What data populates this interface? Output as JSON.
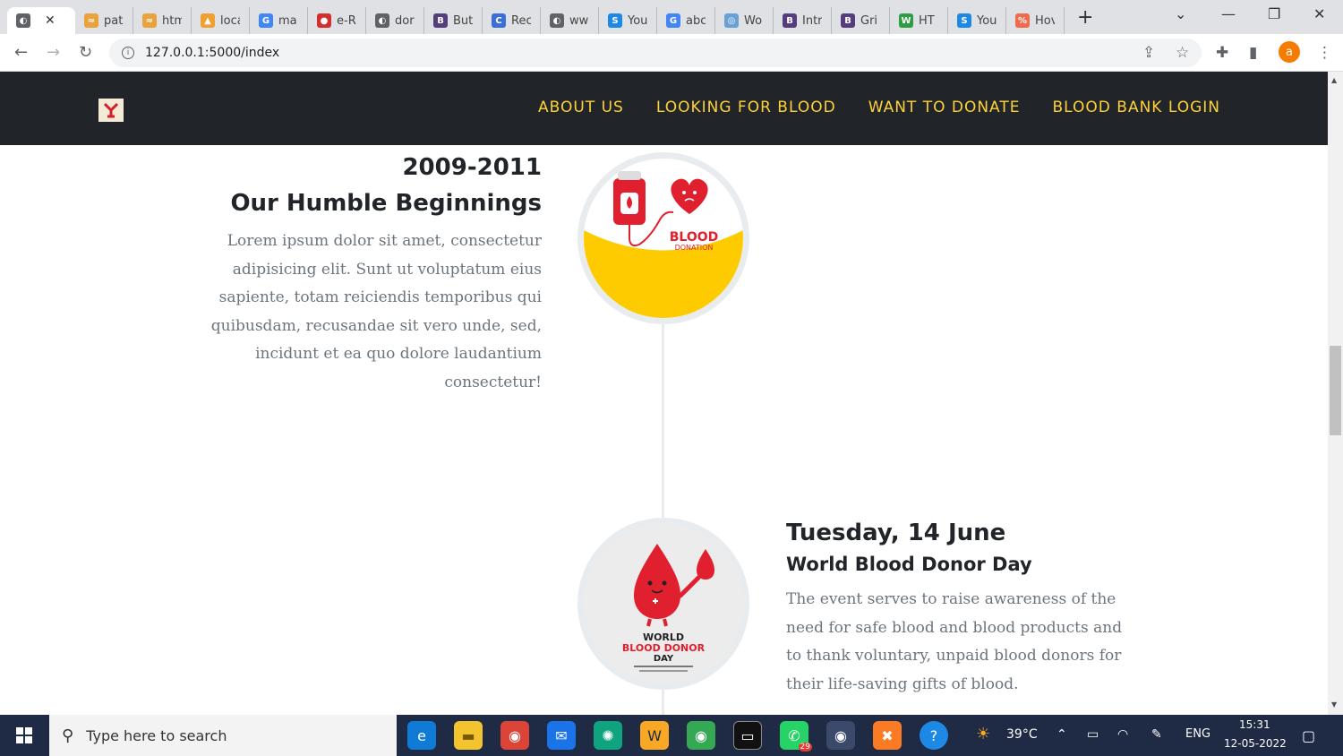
{
  "browser": {
    "tabs": [
      {
        "title": "pat",
        "fav_color": "#e8a33c",
        "glyph": "≈"
      },
      {
        "title": "htm",
        "fav_color": "#e8a33c",
        "glyph": "≈"
      },
      {
        "title": "loca",
        "fav_color": "#f0a030",
        "glyph": "▲"
      },
      {
        "title": "ma",
        "fav_color": "#4285f4",
        "glyph": "G"
      },
      {
        "title": "e-R",
        "fav_color": "#d32f2f",
        "glyph": "●"
      },
      {
        "title": "dor",
        "fav_color": "#5f6368",
        "glyph": "◐"
      },
      {
        "title": "But",
        "fav_color": "#563d7c",
        "glyph": "B"
      },
      {
        "title": "Rec",
        "fav_color": "#3b6fd6",
        "glyph": "C"
      },
      {
        "title": "ww",
        "fav_color": "#5f6368",
        "glyph": "◐"
      },
      {
        "title": "You",
        "fav_color": "#1e88e5",
        "glyph": "S"
      },
      {
        "title": "abc",
        "fav_color": "#4285f4",
        "glyph": "G"
      },
      {
        "title": "Wo",
        "fav_color": "#6aa0d8",
        "glyph": "◎"
      },
      {
        "title": "Intr",
        "fav_color": "#563d7c",
        "glyph": "B"
      },
      {
        "title": "Gri",
        "fav_color": "#563d7c",
        "glyph": "B"
      },
      {
        "title": "HT",
        "fav_color": "#2e9e43",
        "glyph": "W"
      },
      {
        "title": "You",
        "fav_color": "#1e88e5",
        "glyph": "S"
      },
      {
        "title": "Hov",
        "fav_color": "#f06a4e",
        "glyph": "%"
      }
    ],
    "url": "127.0.0.1:5000/index",
    "profile_initial": "a"
  },
  "site": {
    "nav": [
      "ABOUT US",
      "LOOKING FOR BLOOD",
      "WANT TO DONATE",
      "BLOOD BANK LOGIN"
    ],
    "entry1": {
      "date": "2009-2011",
      "title": "Our Humble Beginnings",
      "text": "Lorem ipsum dolor sit amet, consectetur adipisicing elit. Sunt ut voluptatum eius sapiente, totam reiciendis temporibus qui quibusdam, recusandae sit vero unde, sed, incidunt et ea quo dolore laudantium consectetur!",
      "img_text_1": "BLOOD",
      "img_text_2": "DONATION"
    },
    "entry2": {
      "date": "Tuesday, 14 June",
      "title": "World Blood Donor Day",
      "text": "The event serves to raise awareness of the need for safe blood and blood products and to thank voluntary, unpaid blood donors for their life-saving gifts of blood.",
      "img_text_1": "WORLD",
      "img_text_2": "BLOOD DONOR",
      "img_text_3": "DAY"
    }
  },
  "taskbar": {
    "search_placeholder": "Type here to search",
    "weather": "39°C",
    "lang": "ENG",
    "time": "15:31",
    "date": "12-05-2022",
    "whatsapp_badge": "29"
  },
  "colors": {
    "accent": "#fed136",
    "nav_bg": "#212529",
    "blood": "#e0202e"
  }
}
